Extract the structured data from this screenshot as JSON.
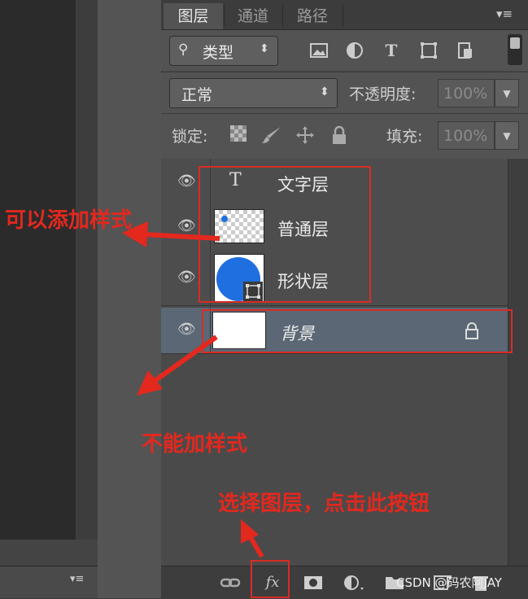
{
  "tabs": [
    "图层",
    "通道",
    "路径"
  ],
  "panel_menu_icon": "panel-menu-icon",
  "filter": {
    "label": "类型",
    "icon": "search-icon"
  },
  "blend_mode": "正常",
  "opacity": {
    "label": "不透明度:",
    "value": "100%"
  },
  "lock": {
    "label": "锁定:"
  },
  "fill": {
    "label": "填充:",
    "value": "100%"
  },
  "layers": [
    {
      "name": "文字层",
      "type": "text"
    },
    {
      "name": "普通层",
      "type": "normal"
    },
    {
      "name": "形状层",
      "type": "shape"
    },
    {
      "name": "背景",
      "type": "background",
      "locked": true
    }
  ],
  "annotations": {
    "can_add_style": "可以添加样式",
    "cannot_add_style": "不能加样式",
    "select_layer_hint": "选择图层，点击此按钮"
  },
  "bottom_bar": {
    "fx_label": "fx"
  },
  "watermark": "CSDN @码农阿JAY",
  "colors": {
    "annotation_red": "#e3281e",
    "selected_layer": "#5b6775",
    "shape_blue": "#1f6fe0"
  }
}
